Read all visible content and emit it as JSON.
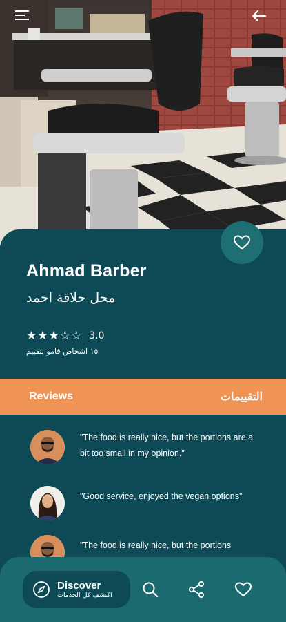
{
  "barber": {
    "name": "Ahmad Barber",
    "name_ar": "محل حلاقة احمد",
    "stars_display": "★★★☆☆",
    "rating": "3.0",
    "reviewers_text": "١٥ اشخاص قامو بتقييم"
  },
  "tabs": {
    "reviews_en": "Reviews",
    "reviews_ar": "التقييمات"
  },
  "reviews": [
    {
      "text": "\"The food is really nice, but the portions are a bit too small in my opinion.\""
    },
    {
      "text": "\"Good service, enjoyed the vegan options\""
    },
    {
      "text": "\"The food is really nice, but the portions"
    }
  ],
  "nav": {
    "discover_label": "Discover",
    "discover_sub": "اكتشف كل الخدمات"
  },
  "icons": [
    "menu-icon",
    "back-arrow-icon",
    "heart-icon",
    "compass-icon",
    "search-icon",
    "share-icon"
  ],
  "colors": {
    "background": "#0e4a55",
    "accent_orange": "#ef9455",
    "nav_bar": "#1a6a70",
    "fav_button": "#1e6f73"
  }
}
